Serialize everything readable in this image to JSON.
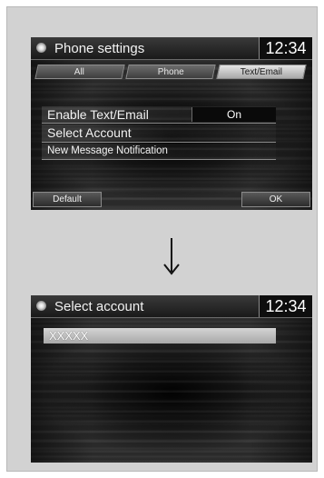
{
  "screen1": {
    "title": "Phone settings",
    "clock": "12:34",
    "tabs": [
      {
        "label": "All",
        "active": false
      },
      {
        "label": "Phone",
        "active": false
      },
      {
        "label": "Text/Email",
        "active": true
      }
    ],
    "menu": [
      {
        "label": "Enable Text/Email",
        "value": "On"
      },
      {
        "label": "Select Account"
      },
      {
        "label": "New Message Notification"
      }
    ],
    "buttons": {
      "default_label": "Default",
      "ok_label": "OK"
    }
  },
  "screen2": {
    "title": "Select account",
    "clock": "12:34",
    "accounts": [
      {
        "label": "XXXXX",
        "selected": true
      }
    ]
  },
  "icons": {
    "status": "settings-dot-icon",
    "transition": "arrow-down-icon"
  },
  "colors": {
    "background": "#d2d2d2",
    "screen": "#262626",
    "text": "#f2f2f2",
    "selected": "#bdbdbd"
  }
}
